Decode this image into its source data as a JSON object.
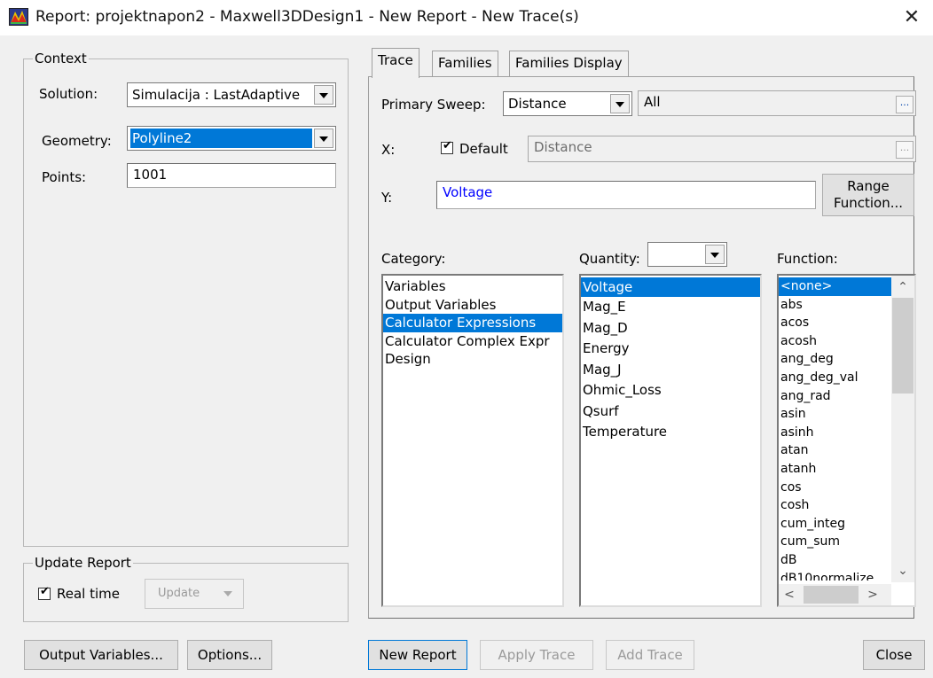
{
  "window": {
    "title": "Report: projektnapon2 - Maxwell3DDesign1 - New Report - New Trace(s)",
    "close_glyph": "✕"
  },
  "context": {
    "legend": "Context",
    "solution_label": "Solution:",
    "solution_value": "Simulacija : LastAdaptive",
    "geometry_label": "Geometry:",
    "geometry_value": "Polyline2",
    "points_label": "Points:",
    "points_value": "1001"
  },
  "update_report": {
    "legend": "Update Report",
    "realtime_label": "Real time",
    "realtime_checked": true,
    "update_button": "Update"
  },
  "tabs": [
    "Trace",
    "Families",
    "Families Display"
  ],
  "trace": {
    "primary_sweep_label": "Primary Sweep:",
    "primary_sweep_value": "Distance",
    "sweep_range_value": "All",
    "ellipsis": "...",
    "x_label": "X:",
    "default_label": "Default",
    "default_checked": true,
    "x_value": "Distance",
    "y_label": "Y:",
    "y_value": "Voltage",
    "range_function_button": [
      "Range",
      "Function..."
    ],
    "category_label": "Category:",
    "quantity_label": "Quantity:",
    "function_label": "Function:",
    "categories": [
      "Variables",
      "Output Variables",
      "Calculator Expressions",
      "Calculator Complex Expr",
      "Design"
    ],
    "categories_selected": "Calculator Expressions",
    "quantities": [
      "Voltage",
      "Mag_E",
      "Mag_D",
      "Energy",
      "Mag_J",
      "Ohmic_Loss",
      "Qsurf",
      "Temperature"
    ],
    "quantities_selected": "Voltage",
    "functions": [
      "<none>",
      "abs",
      "acos",
      "acosh",
      "ang_deg",
      "ang_deg_val",
      "ang_rad",
      "asin",
      "asinh",
      "atan",
      "atanh",
      "cos",
      "cosh",
      "cum_integ",
      "cum_sum",
      "dB",
      "dB10normalize"
    ],
    "functions_selected": "<none>"
  },
  "footer": {
    "output_variables_button": "Output Variables...",
    "options_button": "Options...",
    "new_report_button": "New Report",
    "apply_trace_button": "Apply Trace",
    "add_trace_button": "Add Trace",
    "close_button": "Close"
  },
  "colors": {
    "selection": "#0078d7",
    "y_expression_text": "#0000ff",
    "window_bg": "#f0f0f0"
  },
  "icons": {
    "app": "maxwell-app-icon",
    "close": "close-icon",
    "dropdown": "chevron-down-icon",
    "check": "check-icon"
  }
}
